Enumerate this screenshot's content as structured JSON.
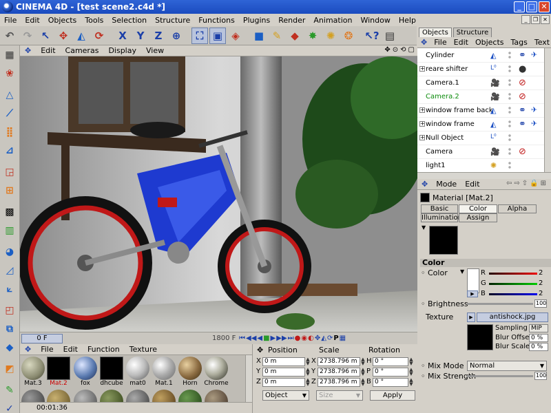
{
  "window": {
    "title": "CINEMA 4D - [test scene2.c4d *]",
    "min": "_",
    "max": "□",
    "close": "✕"
  },
  "menu": [
    "File",
    "Edit",
    "Objects",
    "Tools",
    "Selection",
    "Structure",
    "Functions",
    "Plugins",
    "Render",
    "Animation",
    "Window",
    "Help"
  ],
  "toolbar": {
    "x_label": "X",
    "y_label": "Y",
    "z_label": "Z"
  },
  "viewport": {
    "menu": [
      "Edit",
      "Cameras",
      "Display",
      "View"
    ]
  },
  "timeline": {
    "current_frame": "0 F",
    "end_frame": "1800 F"
  },
  "materials": {
    "menu": [
      "File",
      "Edit",
      "Function",
      "Texture"
    ],
    "items": [
      {
        "name": "Mat.3",
        "color": "#8a8a70"
      },
      {
        "name": "Mat.2",
        "color": "#000000"
      },
      {
        "name": "fox",
        "color": "#5a7ab0"
      },
      {
        "name": "dhcube",
        "color": "#000000"
      },
      {
        "name": "mat0",
        "color": "#bbbbbb"
      },
      {
        "name": "Mat.1",
        "color": "#aaaaaa"
      },
      {
        "name": "Horn",
        "color": "#8a6a40"
      },
      {
        "name": "Chrome",
        "color": "#b0b0a0"
      }
    ],
    "selected": "Mat.2"
  },
  "coords": {
    "headers": {
      "position": "Position",
      "scale": "Scale",
      "rotation": "Rotation"
    },
    "rows": [
      {
        "pos_axis": "X",
        "pos": "0 m",
        "scale_axis": "X",
        "scale": "2738.796 m",
        "rot_axis": "H",
        "rot": "0 °"
      },
      {
        "pos_axis": "Y",
        "pos": "0 m",
        "scale_axis": "Y",
        "scale": "2738.796 m",
        "rot_axis": "P",
        "rot": "0 °"
      },
      {
        "pos_axis": "Z",
        "pos": "0 m",
        "scale_axis": "Z",
        "scale": "2738.796 m",
        "rot_axis": "B",
        "rot": "0 °"
      }
    ],
    "mode": "Object",
    "size_mode": "Size",
    "apply": "Apply"
  },
  "status": {
    "time": "00:01:36"
  },
  "objects": {
    "tabs": [
      "Objects",
      "Structure"
    ],
    "menu": [
      "File",
      "Edit",
      "Objects",
      "Tags",
      "Text"
    ],
    "items": [
      {
        "name": "Cylinder",
        "expandable": false,
        "color": "#000000"
      },
      {
        "name": "reare shifter",
        "expandable": true,
        "color": "#000000"
      },
      {
        "name": "Camera.1",
        "expandable": false,
        "color": "#000000"
      },
      {
        "name": "Camera.2",
        "expandable": false,
        "color": "#0a8a0a"
      },
      {
        "name": "window frame back",
        "expandable": true,
        "color": "#000000"
      },
      {
        "name": "window frame",
        "expandable": true,
        "color": "#000000"
      },
      {
        "name": "Null Object",
        "expandable": true,
        "color": "#000000"
      },
      {
        "name": "Camera",
        "expandable": false,
        "color": "#000000"
      },
      {
        "name": "light1",
        "expandable": false,
        "color": "#000000"
      }
    ]
  },
  "attributes": {
    "menu": [
      "Mode",
      "Edit"
    ],
    "material_title": "Material [Mat.2]",
    "tabs_row1": [
      "Basic",
      "Color",
      "Alpha"
    ],
    "tabs_row2": [
      "Illumination",
      "Assign"
    ],
    "active_tab": "Color",
    "section": "Color",
    "color_label": "Color",
    "r_label": "R",
    "g_label": "G",
    "b_label": "B",
    "r_val": "2",
    "g_val": "2",
    "b_val": "2",
    "brightness_label": "Brightness",
    "brightness_val": "100",
    "texture_label": "Texture",
    "texture_file": "antishock.jpg",
    "sampling_label": "Sampling",
    "sampling_val": "MIP",
    "blur_offset_label": "Blur Offset",
    "blur_offset_val": "0 %",
    "blur_scale_label": "Blur Scale",
    "blur_scale_val": "0 %",
    "mix_mode_label": "Mix Mode",
    "mix_mode_val": "Normal",
    "mix_strength_label": "Mix Strength",
    "mix_strength_val": "100"
  }
}
